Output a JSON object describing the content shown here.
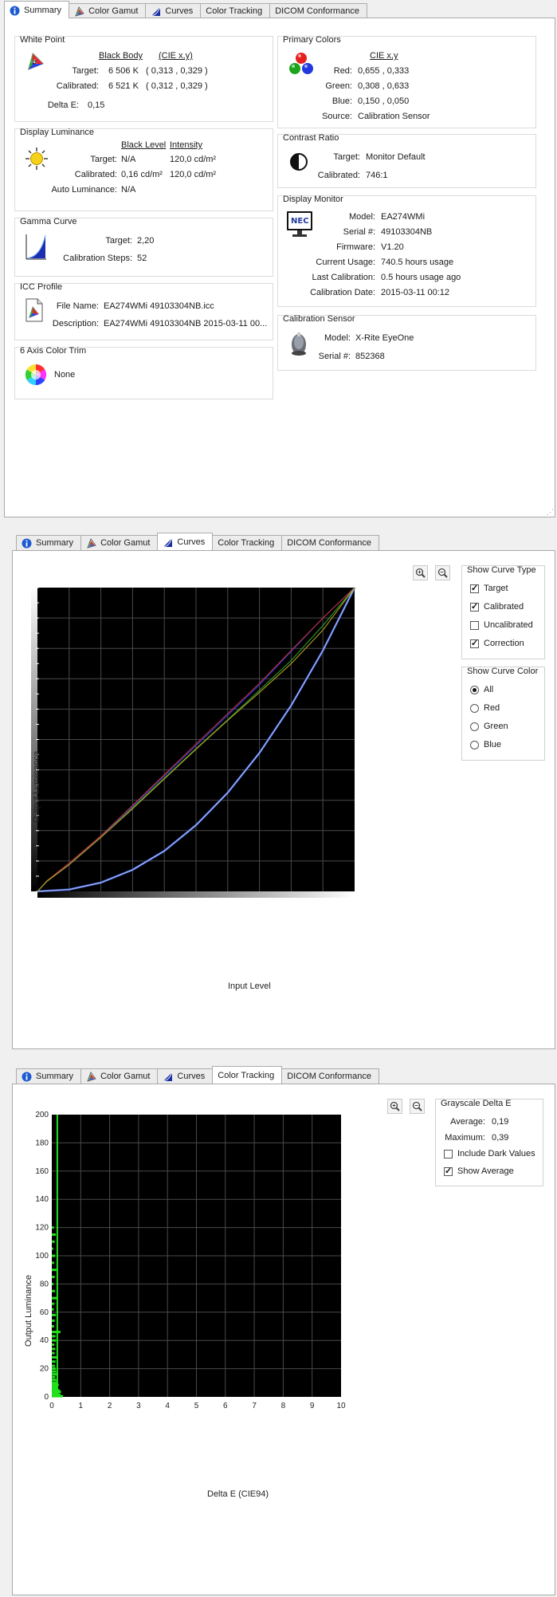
{
  "tabs": [
    "Summary",
    "Color Gamut",
    "Curves",
    "Color Tracking",
    "DICOM Conformance"
  ],
  "summary": {
    "white_point": {
      "title": "White Point",
      "col1": "Black Body",
      "col2": "(CIE x,y)",
      "target_label": "Target:",
      "target_temp": "6 506 K",
      "target_xy": "( 0,313 , 0,329 )",
      "calibrated_label": "Calibrated:",
      "calibrated_temp": "6 521 K",
      "calibrated_xy": "( 0,312 , 0,329 )",
      "delta_label": "Delta E:",
      "delta_value": "0,15"
    },
    "display_luminance": {
      "title": "Display Luminance",
      "col1": "Black Level",
      "col2": "Intensity",
      "target_label": "Target:",
      "target_black": "N/A",
      "target_intensity": "120,0 cd/m²",
      "calibrated_label": "Calibrated:",
      "calibrated_black": "0,16 cd/m²",
      "calibrated_intensity": "120,0 cd/m²",
      "auto_label": "Auto Luminance:",
      "auto_value": "N/A"
    },
    "gamma_curve": {
      "title": "Gamma Curve",
      "target_label": "Target:",
      "target_value": "2,20",
      "steps_label": "Calibration Steps:",
      "steps_value": "52"
    },
    "icc_profile": {
      "title": "ICC Profile",
      "file_label": "File Name:",
      "file_value": "EA274WMi 49103304NB.icc",
      "desc_label": "Description:",
      "desc_value": "EA274WMi 49103304NB 2015-03-11 00..."
    },
    "six_axis": {
      "title": "6 Axis Color Trim",
      "value": "None"
    },
    "primary_colors": {
      "title": "Primary Colors",
      "col": "CIE x,y",
      "red_label": "Red:",
      "red_value": "0,655 , 0,333",
      "green_label": "Green:",
      "green_value": "0,308 , 0,633",
      "blue_label": "Blue:",
      "blue_value": "0,150 , 0,050",
      "source_label": "Source:",
      "source_value": "Calibration Sensor"
    },
    "contrast_ratio": {
      "title": "Contrast Ratio",
      "target_label": "Target:",
      "target_value": "Monitor Default",
      "calibrated_label": "Calibrated:",
      "calibrated_value": "746:1"
    },
    "display_monitor": {
      "title": "Display Monitor",
      "logo": "NEC",
      "model_label": "Model:",
      "model_value": "EA274WMi",
      "serial_label": "Serial #:",
      "serial_value": "49103304NB",
      "firmware_label": "Firmware:",
      "firmware_value": "V1.20",
      "usage_label": "Current Usage:",
      "usage_value": "740.5 hours usage",
      "lastcal_label": "Last Calibration:",
      "lastcal_value": "0.5 hours usage ago",
      "caldate_label": "Calibration Date:",
      "caldate_value": "2015-03-11 00:12"
    },
    "calibration_sensor": {
      "title": "Calibration Sensor",
      "model_label": "Model:",
      "model_value": "X-Rite EyeOne",
      "serial_label": "Serial #:",
      "serial_value": "852368"
    }
  },
  "curves": {
    "ylabel": "Output Luminance",
    "xlabel": "Input Level",
    "show_curve_type": {
      "title": "Show Curve Type",
      "items": [
        {
          "label": "Target",
          "checked": true
        },
        {
          "label": "Calibrated",
          "checked": true
        },
        {
          "label": "Uncalibrated",
          "checked": false
        },
        {
          "label": "Correction",
          "checked": true
        }
      ]
    },
    "show_curve_color": {
      "title": "Show Curve Color",
      "items": [
        {
          "label": "All",
          "selected": true
        },
        {
          "label": "Red",
          "selected": false
        },
        {
          "label": "Green",
          "selected": false
        },
        {
          "label": "Blue",
          "selected": false
        }
      ]
    }
  },
  "tracking": {
    "grayscale": {
      "title": "Grayscale Delta E",
      "avg_label": "Average:",
      "avg_value": "0,19",
      "max_label": "Maximum:",
      "max_value": "0,39",
      "dark_label": "Include Dark Values",
      "dark_checked": false,
      "showavg_label": "Show Average",
      "showavg_checked": true
    }
  },
  "chart_data": [
    {
      "type": "line",
      "xlabel": "Input Level",
      "ylabel": "Output Luminance",
      "xlim": [
        0,
        1
      ],
      "ylim": [
        0,
        1
      ],
      "grid": true,
      "series": [
        {
          "color": "#3060d8",
          "x": [
            0,
            0.1,
            0.2,
            0.3,
            0.4,
            0.5,
            0.6,
            0.7,
            0.8,
            0.9,
            1.0
          ],
          "y": [
            0,
            0.006,
            0.029,
            0.071,
            0.133,
            0.218,
            0.325,
            0.456,
            0.612,
            0.793,
            1.0
          ]
        },
        {
          "color": "#b4b4ee",
          "x": [
            0,
            0.1,
            0.2,
            0.3,
            0.4,
            0.5,
            0.6,
            0.7,
            0.8,
            0.9,
            1.0
          ],
          "y": [
            0,
            0.006,
            0.029,
            0.071,
            0.133,
            0.218,
            0.325,
            0.456,
            0.612,
            0.793,
            1.0
          ]
        },
        {
          "color": "#2a38e0",
          "x": [
            0,
            0.03,
            0.1,
            0.2,
            0.3,
            0.4,
            0.5,
            0.6,
            0.7,
            0.8,
            0.9,
            1.0
          ],
          "y": [
            0,
            0.035,
            0.09,
            0.18,
            0.28,
            0.38,
            0.48,
            0.58,
            0.68,
            0.79,
            0.9,
            1.0
          ]
        },
        {
          "color": "#c03030",
          "x": [
            0,
            0.03,
            0.1,
            0.2,
            0.3,
            0.4,
            0.5,
            0.6,
            0.7,
            0.8,
            0.9,
            1.0
          ],
          "y": [
            0,
            0.035,
            0.093,
            0.183,
            0.283,
            0.384,
            0.485,
            0.585,
            0.685,
            0.793,
            0.9,
            1.0
          ]
        },
        {
          "color": "#2e9a2e",
          "x": [
            0,
            0.03,
            0.1,
            0.2,
            0.3,
            0.4,
            0.5,
            0.6,
            0.7,
            0.8,
            0.9,
            1.0
          ],
          "y": [
            0,
            0.033,
            0.088,
            0.178,
            0.275,
            0.373,
            0.47,
            0.565,
            0.662,
            0.76,
            0.875,
            1.0
          ]
        },
        {
          "color": "#b0a020",
          "x": [
            0,
            0.03,
            0.1,
            0.2,
            0.3,
            0.4,
            0.5,
            0.6,
            0.7,
            0.8,
            0.9,
            1.0
          ],
          "y": [
            0,
            0.033,
            0.088,
            0.178,
            0.272,
            0.37,
            0.468,
            0.563,
            0.655,
            0.75,
            0.86,
            1.0
          ]
        }
      ]
    },
    {
      "type": "bar",
      "xlabel": "Delta E (CIE94)",
      "ylabel": "Output Luminance",
      "xlim": [
        0,
        10
      ],
      "ylim": [
        0,
        200
      ],
      "xticks": [
        0,
        1,
        2,
        3,
        4,
        5,
        6,
        7,
        8,
        9,
        10
      ],
      "yticks": [
        0,
        20,
        40,
        60,
        80,
        100,
        120,
        140,
        160,
        180,
        200
      ],
      "grid": true,
      "average": 0.19,
      "luminance": [
        0.5,
        1.5,
        2.5,
        3.5,
        4.5,
        5.5,
        7,
        8.5,
        10,
        12,
        14,
        16,
        18,
        20,
        22,
        25,
        28,
        31,
        34,
        37,
        40,
        43,
        46,
        50,
        54,
        58,
        62,
        66,
        70,
        75,
        80,
        85,
        90,
        95,
        100,
        105,
        110,
        115,
        120
      ],
      "delta_e": [
        0.39,
        0.3,
        0.25,
        0.32,
        0.28,
        0.22,
        0.2,
        0.24,
        0.18,
        0.16,
        0.12,
        0.19,
        0.15,
        0.14,
        0.11,
        0.13,
        0.17,
        0.1,
        0.12,
        0.09,
        0.15,
        0.13,
        0.3,
        0.08,
        0.1,
        0.14,
        0.07,
        0.09,
        0.2,
        0.11,
        0.06,
        0.1,
        0.16,
        0.08,
        0.12,
        0.05,
        0.1,
        0.14,
        0.07
      ]
    }
  ]
}
